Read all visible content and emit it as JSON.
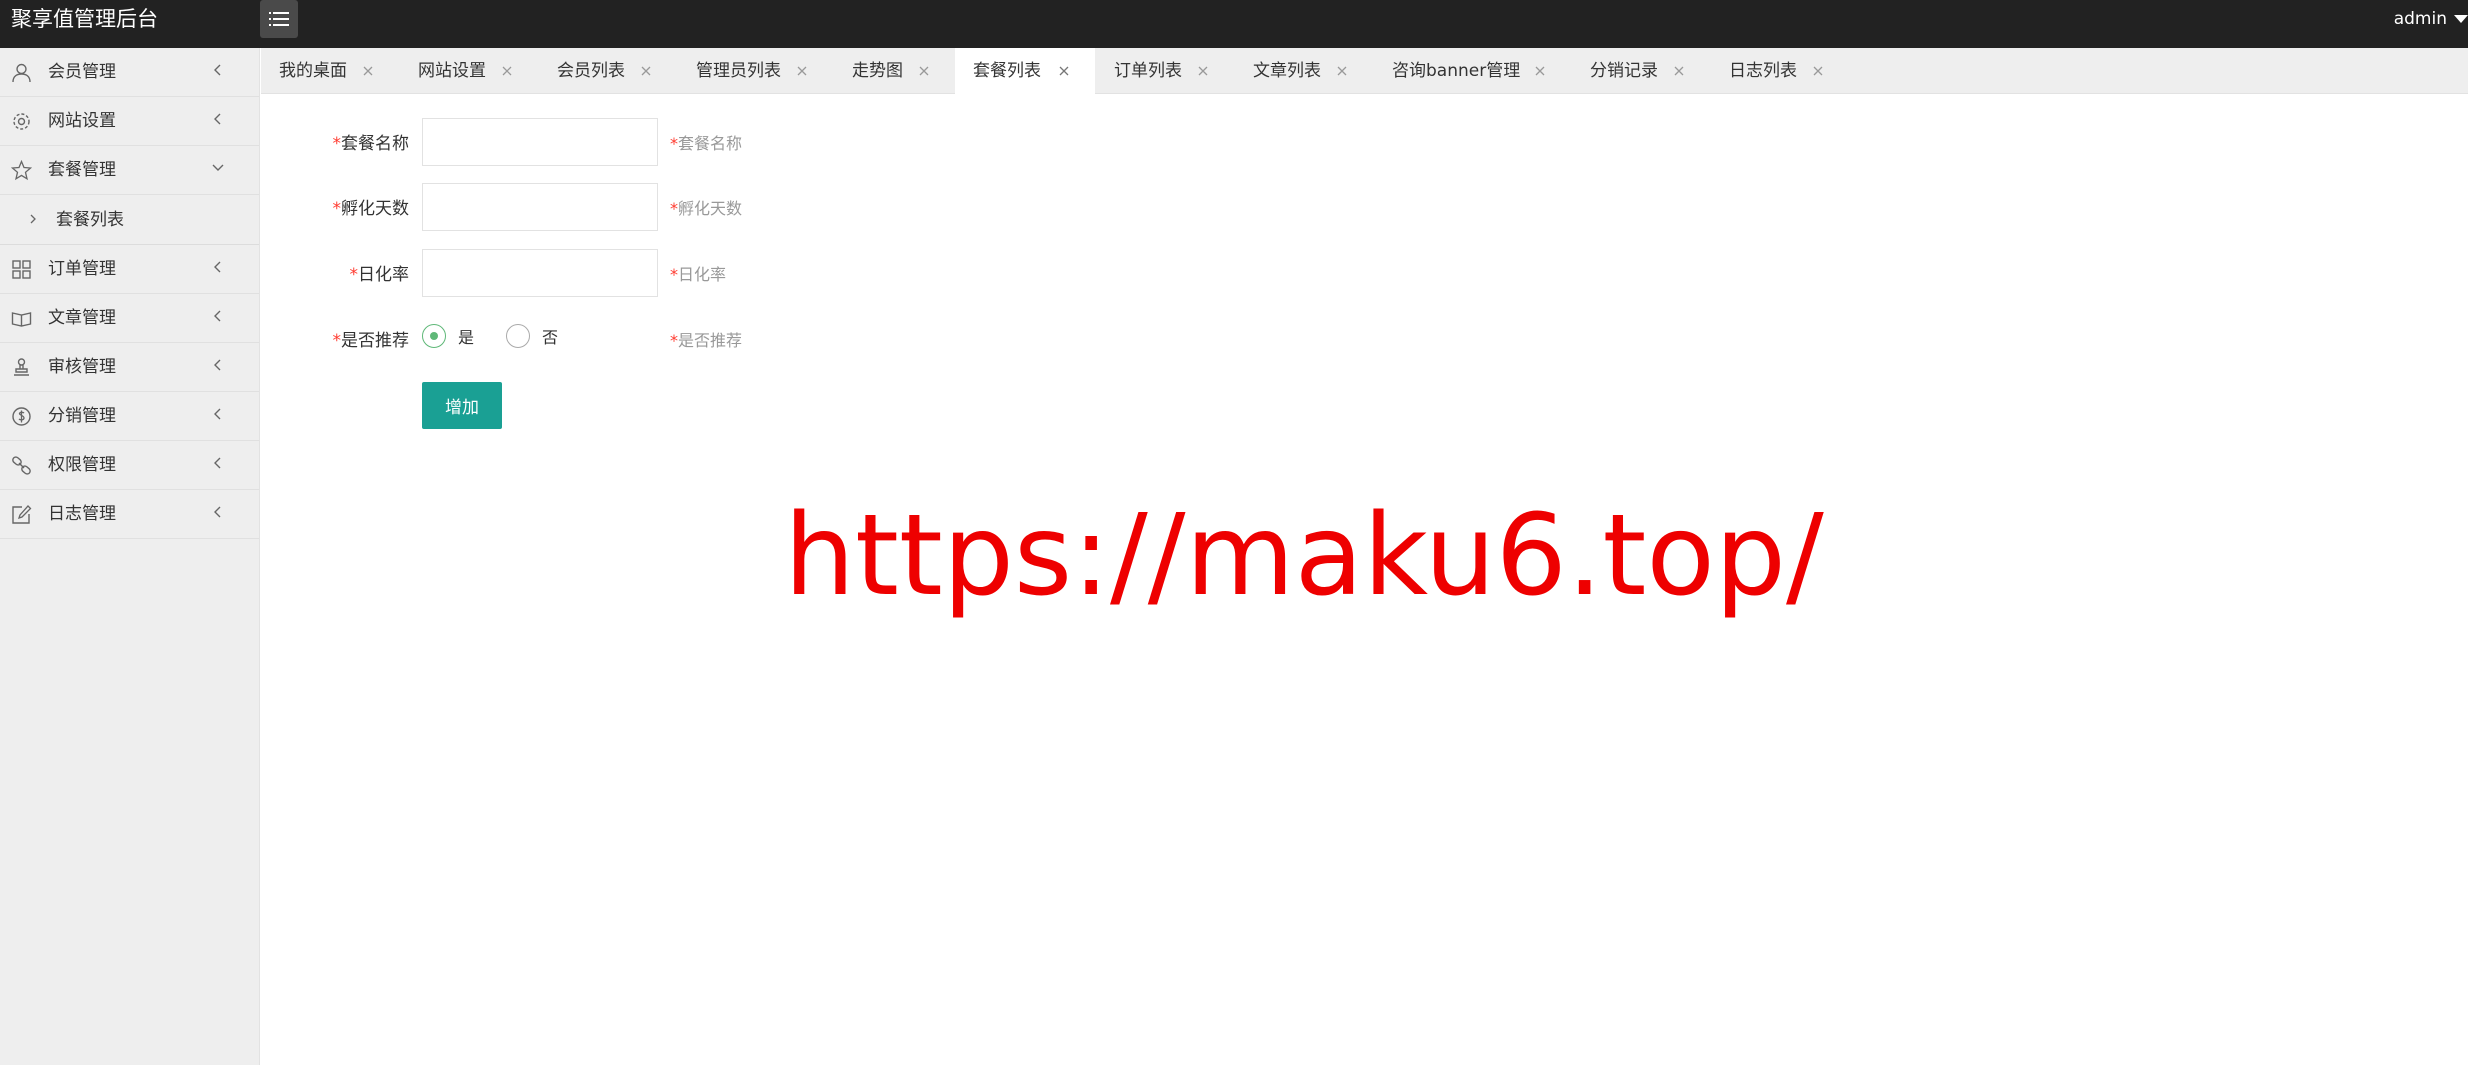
{
  "header": {
    "title": "聚享值管理后台",
    "user": "admin"
  },
  "sidebar": {
    "items": [
      {
        "label": "会员管理",
        "icon": "user-icon"
      },
      {
        "label": "网站设置",
        "icon": "gear-icon"
      },
      {
        "label": "套餐管理",
        "icon": "star-icon",
        "expanded": true,
        "children": [
          {
            "label": "套餐列表"
          }
        ]
      },
      {
        "label": "订单管理",
        "icon": "grid-icon"
      },
      {
        "label": "文章管理",
        "icon": "book-icon"
      },
      {
        "label": "审核管理",
        "icon": "stamp-icon"
      },
      {
        "label": "分销管理",
        "icon": "dollar-icon"
      },
      {
        "label": "权限管理",
        "icon": "link-icon"
      },
      {
        "label": "日志管理",
        "icon": "edit-icon"
      }
    ]
  },
  "tabs": [
    {
      "label": "我的桌面",
      "active": false
    },
    {
      "label": "网站设置",
      "active": false
    },
    {
      "label": "会员列表",
      "active": false
    },
    {
      "label": "管理员列表",
      "active": false
    },
    {
      "label": "走势图",
      "active": false
    },
    {
      "label": "套餐列表",
      "active": true
    },
    {
      "label": "订单列表",
      "active": false
    },
    {
      "label": "文章列表",
      "active": false
    },
    {
      "label": "咨询banner管理",
      "active": false
    },
    {
      "label": "分销记录",
      "active": false
    },
    {
      "label": "日志列表",
      "active": false
    }
  ],
  "form": {
    "required_mark": "*",
    "fields": [
      {
        "label": "套餐名称",
        "value": "",
        "hint": "套餐名称"
      },
      {
        "label": "孵化天数",
        "value": "",
        "hint": "孵化天数"
      },
      {
        "label": "日化率",
        "value": "",
        "hint": "日化率"
      }
    ],
    "recommend": {
      "label": "是否推荐",
      "hint": "是否推荐",
      "options": [
        {
          "label": "是",
          "checked": true
        },
        {
          "label": "否",
          "checked": false
        }
      ]
    },
    "submit_label": "增加"
  },
  "watermark": "https://maku6.top/",
  "colors": {
    "topbar": "#222222",
    "sidebar": "#eeeeee",
    "button": "#1aa094",
    "radio_checked": "#5FB878",
    "required": "#ff3b30",
    "watermark": "#ee0000"
  }
}
